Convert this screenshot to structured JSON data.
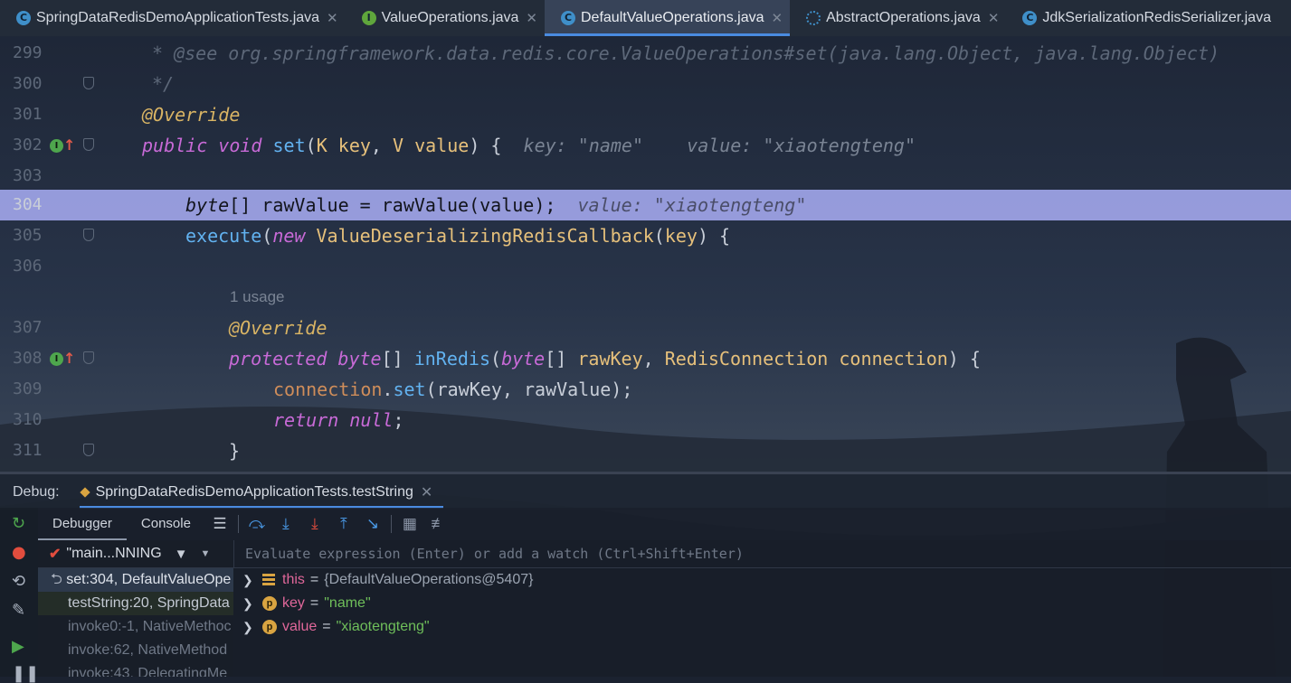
{
  "tabs": [
    {
      "label": "SpringDataRedisDemoApplicationTests.java",
      "icon": "class-icon",
      "active": false
    },
    {
      "label": "ValueOperations.java",
      "icon": "interface-icon",
      "active": false
    },
    {
      "label": "DefaultValueOperations.java",
      "icon": "class-icon",
      "active": true
    },
    {
      "label": "AbstractOperations.java",
      "icon": "abstract-class-icon",
      "active": false
    },
    {
      "label": "JdkSerializationRedisSerializer.java",
      "icon": "class-icon",
      "active": false
    }
  ],
  "editor": {
    "line_numbers": {
      "l299": "299",
      "l300": "300",
      "l301": "301",
      "l302": "302",
      "l303": "303",
      "l304": "304",
      "l305": "305",
      "l306": "306",
      "l307": "307",
      "l308": "308",
      "l309": "309",
      "l310": "310",
      "l311": "311"
    },
    "l299_comment": "* @see org.springframework.data.redis.core.ValueOperations#set(java.lang.Object, java.lang.Object)",
    "l300_comment": "*/",
    "l301_annotation": "@Override",
    "l302": {
      "public": "public",
      "void": "void",
      "set": "set",
      "K": "K",
      "key": "key",
      "V": "V",
      "value": "value",
      "hint": "key: \"name\"    value: \"xiaotengteng\""
    },
    "l304": {
      "byte": "byte",
      "rest1": "[] rawValue = rawValue(value);",
      "hint": "value: \"xiaotengteng\""
    },
    "l305": {
      "execute": "execute",
      "new": "new",
      "callback": "ValueDeserializingRedisCallback",
      "key": "key"
    },
    "usage_hint": "1 usage",
    "l307_annotation": "@Override",
    "l308": {
      "protected": "protected",
      "byte1": "byte",
      "inRedis": "inRedis",
      "byte2": "byte",
      "rawKey": "rawKey",
      "conn_type": "RedisConnection",
      "connection": "connection"
    },
    "l309": {
      "connection": "connection",
      "set": "set",
      "args": "(rawKey, rawValue);"
    },
    "l310": {
      "return": "return",
      "null": "null"
    },
    "l311": {
      "brace": "}"
    },
    "current_line": "304"
  },
  "debug": {
    "label": "Debug:",
    "session": "SpringDataRedisDemoApplicationTests.testString",
    "tabs": {
      "debugger": "Debugger",
      "console": "Console"
    },
    "thread": "\"main...NNING",
    "watch_placeholder": "Evaluate expression (Enter) or add a watch (Ctrl+Shift+Enter)",
    "frames": [
      "set:304, DefaultValueOpe",
      "testString:20, SpringData",
      "invoke0:-1, NativeMethoc",
      "invoke:62, NativeMethod",
      "invoke:43, DelegatingMe"
    ],
    "variables": [
      {
        "name": "this",
        "value": "{DefaultValueOperations@5407}",
        "kind": "field"
      },
      {
        "name": "key",
        "value": "\"name\"",
        "kind": "param"
      },
      {
        "name": "value",
        "value": "\"xiaotengteng\"",
        "kind": "param"
      }
    ]
  },
  "colors": {
    "keyword": "#c86ad7",
    "annotation": "#d9b464",
    "method": "#62b2f0",
    "type_param": "#e6c07b",
    "string": "#6fbf5a",
    "exec_highlight": "#a0a5e8"
  }
}
